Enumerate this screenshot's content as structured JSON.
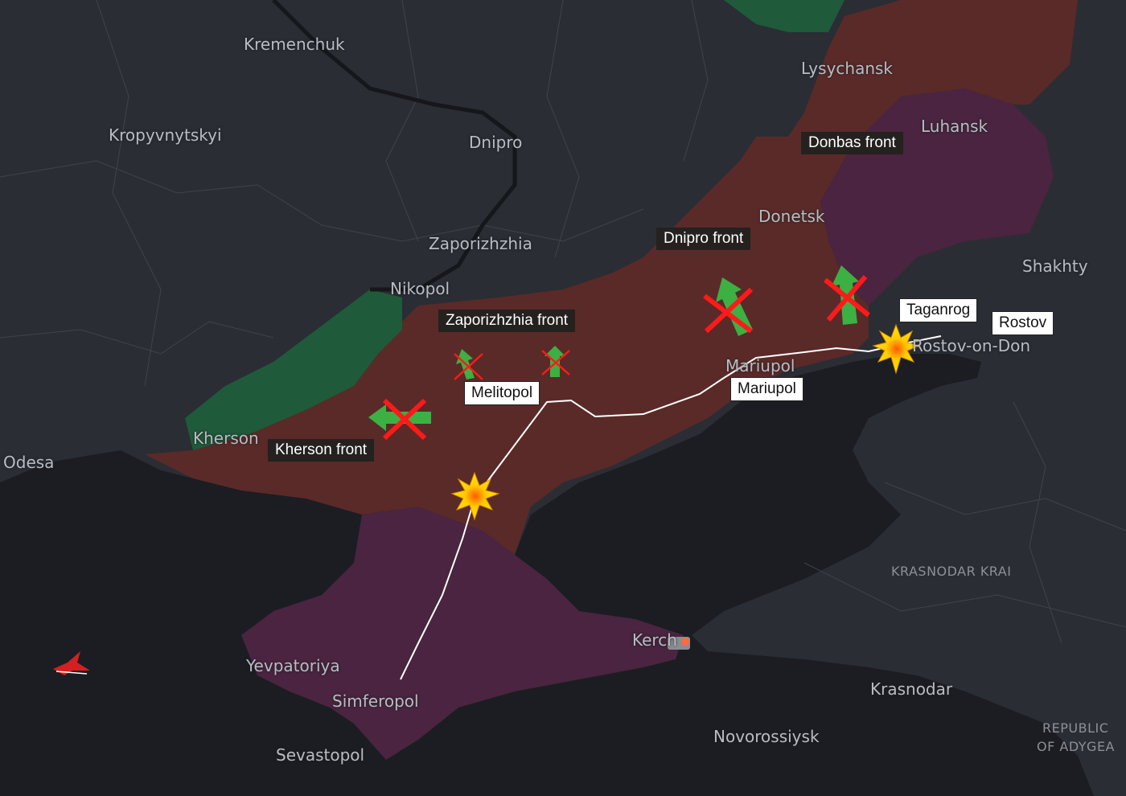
{
  "cities": {
    "kremenchuk": "Kremenchuk",
    "kropyvnytskyi": "Kropyvnytskyi",
    "dnipro": "Dnipro",
    "lysychansk": "Lysychansk",
    "luhansk": "Luhansk",
    "donetsk": "Donetsk",
    "zaporizhzhia": "Zaporizhzhia",
    "nikopol": "Nikopol",
    "shakhty": "Shakhty",
    "mariupol": "Mariupol",
    "rostov_on_don": "Rostov-on-Don",
    "kherson": "Kherson",
    "odesa": "Odesa",
    "krasnodar_krai": "KRASNODAR KRAI",
    "kerch": "Kerch",
    "krasnodar": "Krasnodar",
    "yevpatoriya": "Yevpatoriya",
    "simferopol": "Simferopol",
    "novorossiysk": "Novorossiysk",
    "sevastopol": "Sevastopol",
    "republic_of_adygea_1": "REPUBLIC",
    "republic_of_adygea_2": "OF ADYGEA"
  },
  "fronts": {
    "donbas": "Donbas front",
    "dnipro": "Dnipro front",
    "zaporizhzhia": "Zaporizhzhia front",
    "kherson": "Kherson front"
  },
  "tags": {
    "taganrog": "Taganrog",
    "rostov": "Rostov",
    "melitopol": "Melitopol",
    "mariupol": "Mariupol"
  },
  "colors": {
    "land": "#2a2d34",
    "sea": "#1b1d22",
    "occupied": "#5a2a28",
    "russia_held": "#4a2440",
    "ukraine_liberated": "#1f5a3a",
    "arrow": "#3cb043",
    "cross": "#ff1a1a",
    "explosion": "#ffd400"
  }
}
